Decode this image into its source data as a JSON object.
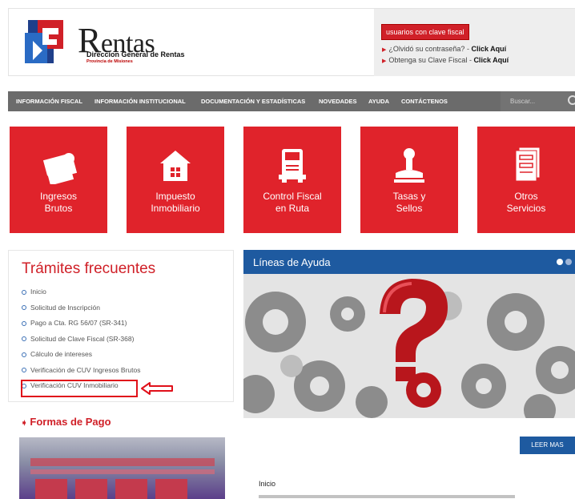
{
  "header": {
    "logo_initial": "R",
    "logo_rest": "entas",
    "logo_line1": "Direccion General de Rentas",
    "logo_line2": "Provincia de Misiones",
    "clave_badge": "usuarios con clave fiscal",
    "link1_text": "¿Olvidó su contraseña? - ",
    "link1_bold": "Click Aquí",
    "link2_text": "Obtenga su Clave Fiscal - ",
    "link2_bold": "Click Aquí"
  },
  "nav": {
    "items": [
      "INFORMACIÓN FISCAL",
      "INFORMACIÓN INSTITUCIONAL",
      "DOCUMENTACIÓN Y ESTADÍSTICAS",
      "NOVEDADES",
      "AYUDA",
      "CONTÁCTENOS"
    ],
    "search_placeholder": "Buscar..."
  },
  "tiles": [
    {
      "l1": "Ingresos",
      "l2": "Brutos",
      "icon": "money-stack-icon"
    },
    {
      "l1": "Impuesto",
      "l2": "Inmobiliario",
      "icon": "house-icon"
    },
    {
      "l1": "Control Fiscal",
      "l2": "en Ruta",
      "icon": "truck-icon"
    },
    {
      "l1": "Tasas y",
      "l2": "Sellos",
      "icon": "stamp-icon"
    },
    {
      "l1": "Otros",
      "l2": "Servicios",
      "icon": "documents-icon"
    }
  ],
  "tramites": {
    "title": "Trámites frecuentes",
    "items": [
      "Inicio",
      "Solicitud de Inscripción",
      "Pago a Cta. RG 56/07 (SR-341)",
      "Solicitud de Clave Fiscal (SR-368)",
      "Cálculo de intereses",
      "Verificación de CUV Ingresos Brutos",
      "Verificación CUV Inmobiliario"
    ]
  },
  "formas": {
    "title": "Formas de Pago"
  },
  "ayuda": {
    "title": "Líneas de Ayuda",
    "leer_mas": "LEER MAS",
    "inicio": "Inicio"
  },
  "colors": {
    "brand_red": "#e0232b",
    "nav_gray": "#6b6b6b",
    "accent_blue": "#1e5aa0"
  }
}
